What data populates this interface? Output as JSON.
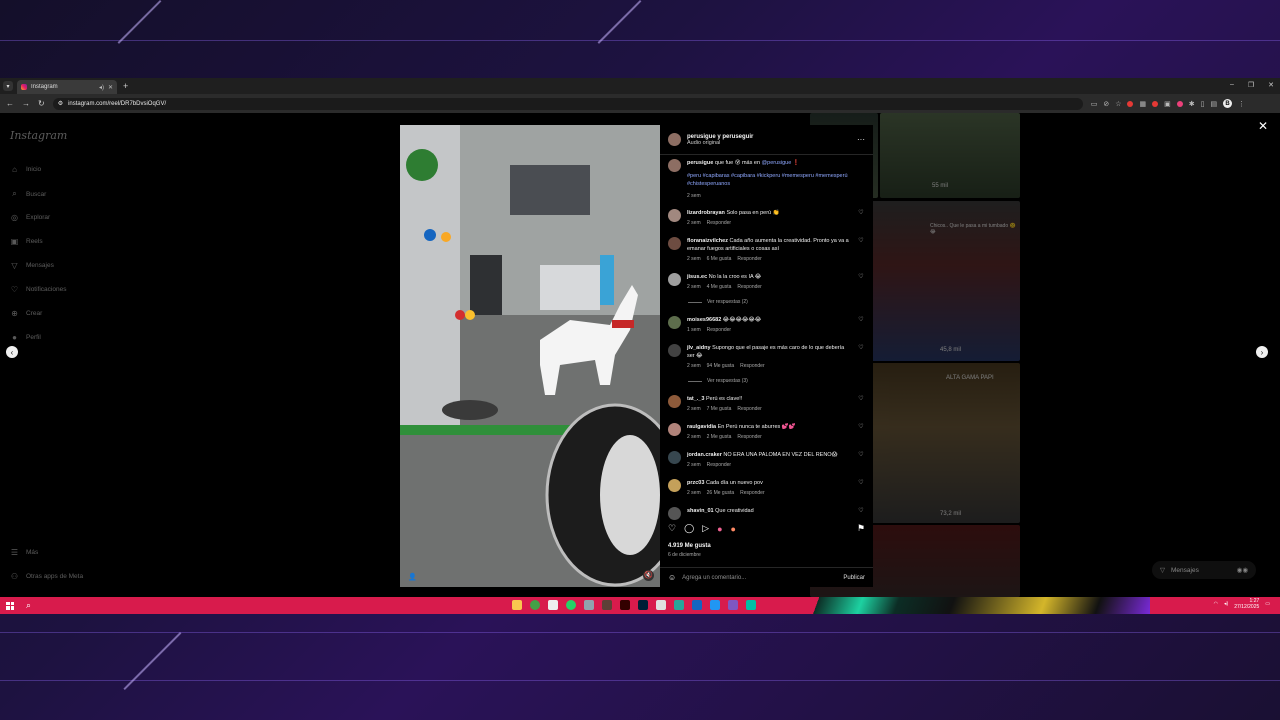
{
  "browser": {
    "tab_title": "Instagram",
    "url": "instagram.com/reel/DR7bDvsiOqGV/"
  },
  "sidebar": {
    "logo": "Instagram",
    "items": [
      {
        "label": "Inicio",
        "icon": "home-icon"
      },
      {
        "label": "Buscar",
        "icon": "search-icon"
      },
      {
        "label": "Explorar",
        "icon": "compass-icon"
      },
      {
        "label": "Reels",
        "icon": "reels-icon"
      },
      {
        "label": "Mensajes",
        "icon": "send-icon"
      },
      {
        "label": "Notificaciones",
        "icon": "heart-icon"
      },
      {
        "label": "Crear",
        "icon": "plus-icon"
      },
      {
        "label": "Perfil",
        "icon": "avatar-icon"
      }
    ],
    "more": "Más",
    "meta_apps": "Otras apps de Meta"
  },
  "feed_tiles": [
    {
      "views": "55 mil"
    },
    {
      "caption": "Chicos.. Que le pasa a mi tumbado ☹️😂"
    },
    {
      "views": "45,8 mil"
    },
    {
      "caption": "ALTA GAMA PAPI"
    },
    {
      "views": "73,2 mil"
    }
  ],
  "post": {
    "author": "perusigue y peruseguir",
    "audio": "Audio original",
    "caption_user": "perusigue",
    "caption_text": "que fue 😵 más en ",
    "caption_mention": "@perusigue",
    "caption_end": " ❗",
    "hashtags": "#peru #capibaras #capibara #kickperu #memesperu #memesperú #chistesperuanos",
    "caption_time": "2 sem",
    "likes": "4.919 Me gusta",
    "date": "6 de diciembre",
    "comment_placeholder": "Agrega un comentario...",
    "publish": "Publicar"
  },
  "comments": [
    {
      "user": "lizardrobrayan",
      "text": "Solo pasa en perú 👏",
      "time": "2 sem",
      "likes": "",
      "reply": "Responder"
    },
    {
      "user": "floranaizvilchez",
      "text": "Cada año aumenta la creatividad. Pronto ya va a emanar fuegos artificiales o cosas así",
      "time": "2 sem",
      "likes": "6 Me gusta",
      "reply": "Responder"
    },
    {
      "user": "jisus.ec",
      "text": "No la la croo es IA 😂",
      "time": "2 sem",
      "likes": "4 Me gusta",
      "reply": "Responder",
      "replies": "Ver respuestas (2)"
    },
    {
      "user": "moises96682",
      "text": "😂😂😂😂😂😂",
      "time": "1 sem",
      "likes": "",
      "reply": "Responder"
    },
    {
      "user": "jlv_aidny",
      "text": "Supongo que el pasaje es más caro de lo que debería ser 😂",
      "time": "2 sem",
      "likes": "94 Me gusta",
      "reply": "Responder",
      "replies": "Ver respuestas (3)"
    },
    {
      "user": "tat_._3",
      "text": "Perú es clave!!",
      "time": "2 sem",
      "likes": "7 Me gusta",
      "reply": "Responder"
    },
    {
      "user": "raulgavidia",
      "text": "En Perú nunca te aburres 💕💕",
      "time": "2 sem",
      "likes": "2 Me gusta",
      "reply": "Responder"
    },
    {
      "user": "jordan.craker",
      "text": "NO ERA UNA PALOMA EN VEZ DEL RENO😱",
      "time": "2 sem",
      "likes": "",
      "reply": "Responder"
    },
    {
      "user": "przc03",
      "text": "Cada día un nuevo pov",
      "time": "2 sem",
      "likes": "26 Me gusta",
      "reply": "Responder"
    },
    {
      "user": "shavin_01",
      "text": "Que creatividad",
      "time": "",
      "likes": "",
      "reply": ""
    }
  ],
  "dm": {
    "label": "Mensajes"
  },
  "taskbar": {
    "time": "1:27",
    "date": "27/12/2025"
  },
  "colors": {
    "taskbar": "#d81b4c",
    "link": "#8fa8ff"
  }
}
